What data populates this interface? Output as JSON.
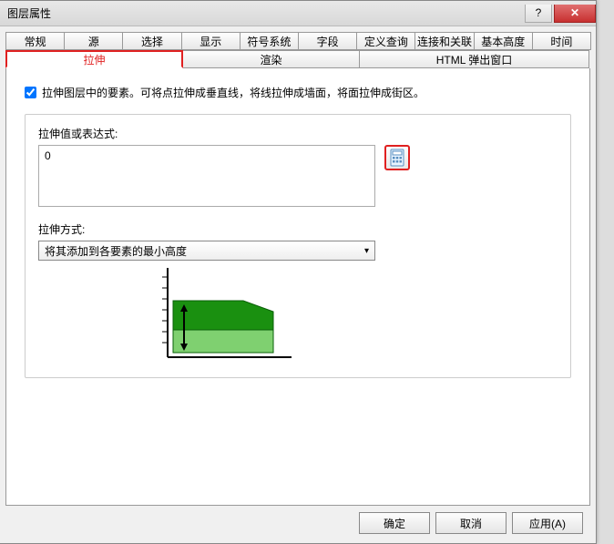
{
  "window": {
    "title": "图层属性"
  },
  "tabs_row1": [
    {
      "label": "常规"
    },
    {
      "label": "源"
    },
    {
      "label": "选择"
    },
    {
      "label": "显示"
    },
    {
      "label": "符号系统"
    },
    {
      "label": "字段"
    },
    {
      "label": "定义查询"
    },
    {
      "label": "连接和关联"
    },
    {
      "label": "基本高度"
    },
    {
      "label": "时间"
    }
  ],
  "tabs_row2": [
    {
      "label": "拉伸",
      "active": true
    },
    {
      "label": "渲染"
    },
    {
      "label": "HTML 弹出窗口"
    }
  ],
  "form": {
    "checkbox_label": "拉伸图层中的要素。可将点拉伸成垂直线，将线拉伸成墙面，将面拉伸成街区。",
    "checked": true,
    "expression_label": "拉伸值或表达式:",
    "expression_value": "0",
    "way_label": "拉伸方式:",
    "way_selected": "将其添加到各要素的最小高度"
  },
  "buttons": {
    "ok": "确定",
    "cancel": "取消",
    "apply": "应用(A)"
  },
  "icons": {
    "help": "?",
    "close": "✕",
    "chevron": "▾"
  }
}
